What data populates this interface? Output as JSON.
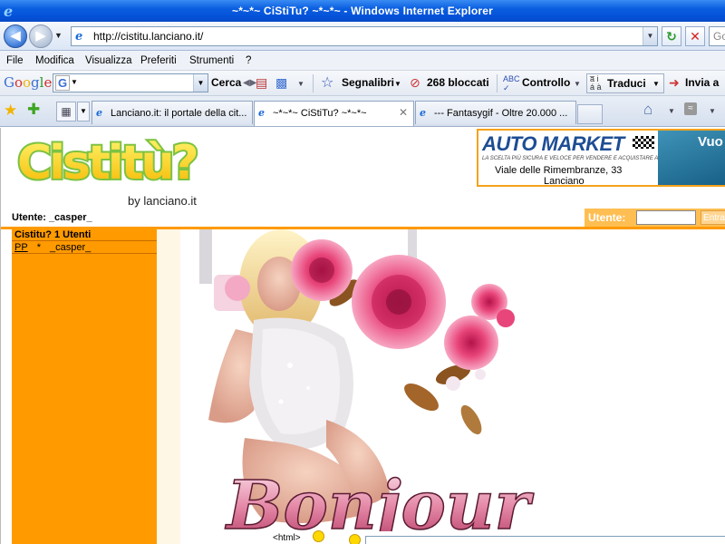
{
  "window": {
    "title": "~*~*~ CiStiTu? ~*~*~ - Windows Internet Explorer"
  },
  "address": {
    "url": "http://cistitu.lanciano.it/",
    "search_placeholder": "Go"
  },
  "menu": {
    "items": [
      "File",
      "Modifica",
      "Visualizza",
      "Preferiti",
      "Strumenti",
      "?"
    ]
  },
  "google_toolbar": {
    "brand": "Google",
    "search_label": "Cerca",
    "bookmarks_label": "Segnalibri",
    "blocked_label": "268 bloccati",
    "spellcheck_label": "Controllo",
    "translate_label": "Traduci",
    "send_label": "Invia a"
  },
  "tabs": [
    {
      "label": "Lanciano.it: il portale della cit...",
      "active": false
    },
    {
      "label": "~*~*~ CiStiTu? ~*~*~",
      "active": true
    },
    {
      "label": "--- Fantasygif - Oltre 20.000 ...",
      "active": false
    }
  ],
  "site": {
    "logo_text": "Cistitù?",
    "byline": "by lanciano.it",
    "current_user": "Utente: _casper_",
    "login_label": "Utente:",
    "login_button": "Entra"
  },
  "ad": {
    "brand": "AUTO MARKET",
    "tagline": "LA SCELTA PIÙ SICURA E VELOCE PER VENDERE E ACQUISTARE AUTO",
    "address": "Viale delle Rimembranze, 33",
    "city": "Lanciano",
    "side_text": "Vuo"
  },
  "sidebar": {
    "header": "Cistitu? 1 Utenti",
    "users": [
      {
        "tag": "PP",
        "marker": "*",
        "name": "_casper_"
      }
    ]
  },
  "artwork": {
    "caption": "Bonjour"
  },
  "editor": {
    "html_button": "<html>"
  },
  "colors": {
    "accent_orange": "#ff9a00",
    "xp_blue": "#0a5ee0",
    "rose_pink": "#e8457a"
  }
}
